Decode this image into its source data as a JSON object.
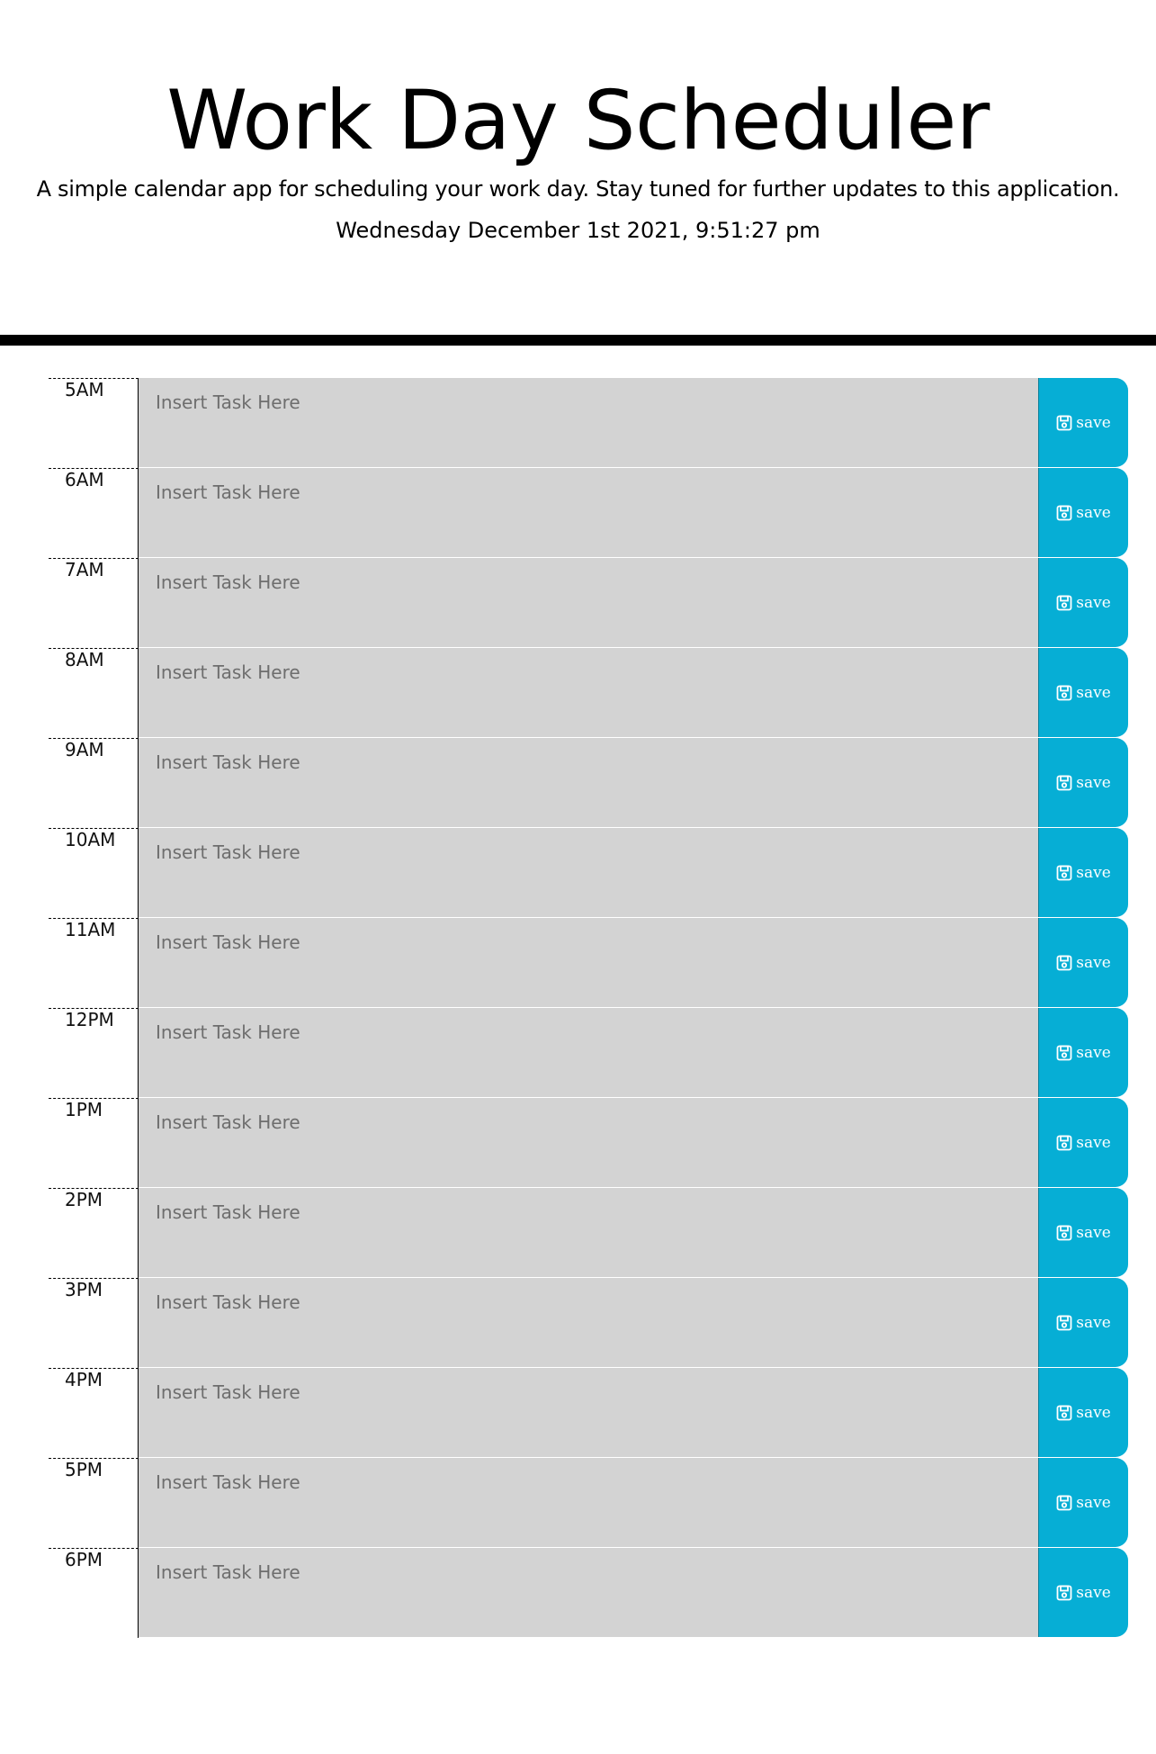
{
  "header": {
    "title": "Work Day Scheduler",
    "lead": "A simple calendar app for scheduling your work day. Stay tuned for further updates to this application.",
    "current_day": "Wednesday December 1st 2021, 9:51:27 pm"
  },
  "schedule": {
    "placeholder": "Insert Task Here",
    "save_label": "save",
    "save_icon": "floppy-disk-icon",
    "colors": {
      "task_background": "#d3d3d3",
      "save_button": "#06aed5"
    },
    "hours": [
      {
        "label": "5AM",
        "task": ""
      },
      {
        "label": "6AM",
        "task": ""
      },
      {
        "label": "7AM",
        "task": ""
      },
      {
        "label": "8AM",
        "task": ""
      },
      {
        "label": "9AM",
        "task": ""
      },
      {
        "label": "10AM",
        "task": ""
      },
      {
        "label": "11AM",
        "task": ""
      },
      {
        "label": "12PM",
        "task": ""
      },
      {
        "label": "1PM",
        "task": ""
      },
      {
        "label": "2PM",
        "task": ""
      },
      {
        "label": "3PM",
        "task": ""
      },
      {
        "label": "4PM",
        "task": ""
      },
      {
        "label": "5PM",
        "task": ""
      },
      {
        "label": "6PM",
        "task": ""
      }
    ]
  }
}
